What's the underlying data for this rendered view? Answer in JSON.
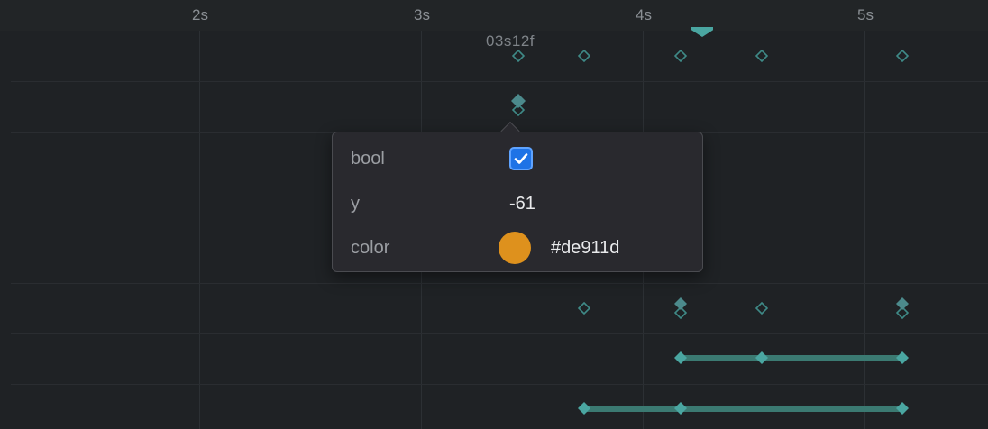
{
  "ruler": {
    "ticks": [
      "2s",
      "3s",
      "4s",
      "5s"
    ]
  },
  "playhead": {
    "frame_label": "03s12f"
  },
  "popover": {
    "rows": [
      {
        "label": "bool",
        "checked": true
      },
      {
        "label": "y",
        "value": "-61"
      },
      {
        "label": "color",
        "value": "#de911d",
        "swatch_color": "#de911d"
      }
    ]
  },
  "colors": {
    "accent": "#4aa6a1",
    "keyframe_outline": "#3f8a87",
    "background": "#1f2225",
    "popover_bg": "#29292e",
    "checkbox": "#1e73e6"
  },
  "icons": {
    "checkbox": "checkmark-icon",
    "playhead": "playhead-marker-icon",
    "keyframe": "diamond-icon"
  }
}
